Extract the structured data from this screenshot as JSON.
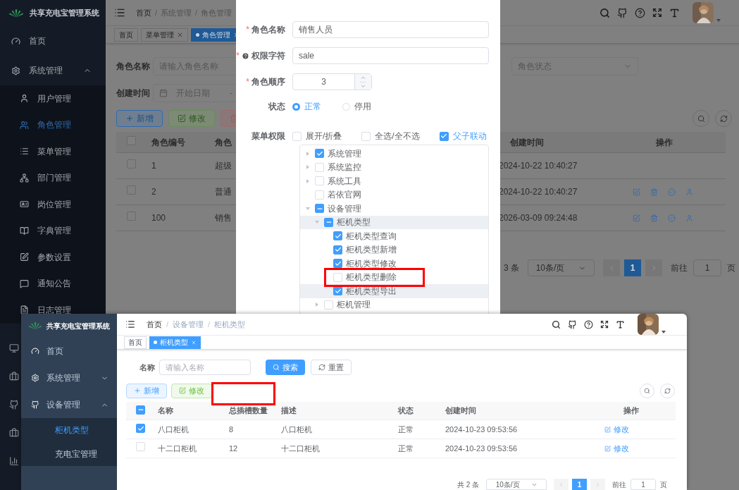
{
  "top": {
    "sidebar": {
      "title": "共享充电宝管理系统",
      "items": [
        {
          "label": "首页"
        },
        {
          "label": "系统管理",
          "expanded": true,
          "children": [
            {
              "label": "用户管理",
              "selected": false
            },
            {
              "label": "角色管理",
              "selected": true
            },
            {
              "label": "菜单管理",
              "selected": false
            },
            {
              "label": "部门管理",
              "selected": false
            },
            {
              "label": "岗位管理",
              "selected": false
            },
            {
              "label": "字典管理",
              "selected": false
            },
            {
              "label": "参数设置",
              "selected": false
            },
            {
              "label": "通知公告",
              "selected": false
            },
            {
              "label": "日志管理",
              "selected": false
            }
          ]
        }
      ]
    },
    "breadcrumb": [
      "首页",
      "/",
      "系统管理",
      "/",
      "角色管理"
    ],
    "tabs": [
      {
        "label": "首页",
        "selected": false,
        "closable": false
      },
      {
        "label": "菜单管理",
        "selected": false,
        "closable": true
      },
      {
        "label": "角色管理",
        "selected": true,
        "closable": true
      }
    ],
    "filters": {
      "name_label": "角色名称",
      "name_placeholder": "请输入角色名称",
      "date_label": "创建时间",
      "start_placeholder": "开始日期",
      "separator": "-",
      "status_placeholder": "角色状态"
    },
    "toolbar": [
      "新增",
      "修改"
    ],
    "table": {
      "all_checked": false,
      "columns": [
        "角色编号",
        "角色",
        "创建时间",
        "操作"
      ],
      "rows": [
        {
          "checked": false,
          "id": "1",
          "name": "超级",
          "created": "2024-10-22 10:40:27",
          "actions": false
        },
        {
          "checked": false,
          "id": "2",
          "name": "普通",
          "created": "2024-10-22 10:40:27",
          "actions": true
        },
        {
          "checked": false,
          "id": "100",
          "name": "销售",
          "created": "2026-03-09 09:24:48",
          "actions": true
        }
      ]
    },
    "pagination": {
      "total": "3 条",
      "page_size": "10条/页",
      "page": "1",
      "goto_label": "前往",
      "goto_value": "1",
      "suffix": "页"
    }
  },
  "dialog": {
    "fields": [
      {
        "label": "角色名称",
        "required_mark": "*",
        "help": false,
        "kind": "text",
        "value": "销售人员"
      },
      {
        "label": "权限字符",
        "required_mark": "*",
        "help": true,
        "kind": "text",
        "value": "sale"
      },
      {
        "label": "角色顺序",
        "required_mark": "*",
        "help": false,
        "kind": "number",
        "value": "3"
      },
      {
        "label": "状态",
        "help": false,
        "kind": "radio",
        "options": [
          {
            "label": "正常",
            "selected": true
          },
          {
            "label": "停用",
            "selected": false
          }
        ]
      },
      {
        "label": "菜单权限",
        "help": false,
        "kind": "checks",
        "options": [
          {
            "label": "展开/折叠",
            "checked": false
          },
          {
            "label": "全选/全不选",
            "checked": false
          },
          {
            "label": "父子联动",
            "checked": true
          }
        ]
      }
    ],
    "tree": [
      {
        "label": "系统管理",
        "checked": true,
        "expanded": false,
        "current": false
      },
      {
        "label": "系统监控",
        "checked": false,
        "expanded": false,
        "current": false
      },
      {
        "label": "系统工具",
        "checked": false,
        "expanded": false,
        "current": false
      },
      {
        "label": "若依官网",
        "checked": false,
        "current": false
      },
      {
        "label": "设备管理",
        "indeterminate": true,
        "expanded": true,
        "current": false,
        "children": [
          {
            "label": "柜机类型",
            "indeterminate": true,
            "expanded": true,
            "current": true,
            "children": [
              {
                "label": "柜机类型查询",
                "checked": true,
                "current": false
              },
              {
                "label": "柜机类型新增",
                "checked": true,
                "current": false
              },
              {
                "label": "柜机类型修改",
                "checked": true,
                "current": false
              },
              {
                "label": "柜机类型删除",
                "checked": false,
                "current": false
              },
              {
                "label": "柜机类型导出",
                "checked": true,
                "current": true
              }
            ]
          },
          {
            "label": "柜机管理",
            "checked": false,
            "expanded": false,
            "current": false
          }
        ]
      }
    ]
  },
  "bottom": {
    "sidebar": {
      "title": "共享充电宝管理系统",
      "items": [
        {
          "label": "首页"
        },
        {
          "label": "系统管理",
          "expanded": false
        },
        {
          "label": "设备管理",
          "expanded": true,
          "children": [
            {
              "label": "柜机类型",
              "selected": true
            },
            {
              "label": "充电宝管理",
              "selected": false
            }
          ]
        }
      ]
    },
    "breadcrumb": [
      "首页",
      "/",
      "设备管理",
      "/",
      "柜机类型"
    ],
    "tabs": [
      {
        "label": "首页",
        "selected": false,
        "closable": false
      },
      {
        "label": "柜机类型",
        "selected": true,
        "closable": true
      }
    ],
    "filters": {
      "name_label": "名称",
      "name_placeholder": "请输入名称",
      "search": "搜索",
      "reset": "重置"
    },
    "toolbar": [
      "新增",
      "修改"
    ],
    "table": {
      "all_indeterminate": true,
      "columns": [
        "名称",
        "总插槽数量",
        "描述",
        "状态",
        "创建时间",
        "操作"
      ],
      "rows": [
        {
          "checked": true,
          "name": "八口柜机",
          "slots": "8",
          "desc": "八口柜机",
          "status": "正常",
          "created": "2024-10-23 09:53:56",
          "action": "修改"
        },
        {
          "checked": false,
          "name": "十二口柜机",
          "slots": "12",
          "desc": "十二口柜机",
          "status": "正常",
          "created": "2024-10-23 09:53:56",
          "action": "修改"
        }
      ]
    },
    "pagination": {
      "total": "共 2 条",
      "page_size": "10条/页",
      "page": "1",
      "goto_label": "前往",
      "goto_value": "1",
      "suffix": "页"
    }
  }
}
